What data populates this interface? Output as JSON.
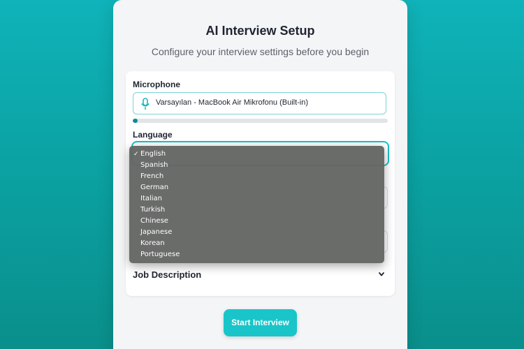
{
  "header": {
    "title": "AI Interview Setup",
    "subtitle": "Configure your interview settings before you begin"
  },
  "microphone": {
    "label": "Microphone",
    "selected": "Varsayılan - MacBook Air Mikrofonu (Built-in)",
    "input_level": 0.02,
    "icon": "microphone-icon"
  },
  "language": {
    "label": "Language",
    "selected": "English",
    "options": [
      {
        "label": "English",
        "check": "✓"
      },
      {
        "label": "Spanish",
        "check": ""
      },
      {
        "label": "French",
        "check": ""
      },
      {
        "label": "German",
        "check": ""
      },
      {
        "label": "Italian",
        "check": ""
      },
      {
        "label": "Turkish",
        "check": ""
      },
      {
        "label": "Chinese",
        "check": ""
      },
      {
        "label": "Japanese",
        "check": ""
      },
      {
        "label": "Korean",
        "check": ""
      },
      {
        "label": "Portuguese",
        "check": ""
      }
    ]
  },
  "job_description": {
    "label": "Job Description",
    "icon": "chevron-down-icon"
  },
  "actions": {
    "start_label": "Start Interview"
  },
  "colors": {
    "accent": "#19c5c9",
    "level_fill": "#0b8d92"
  }
}
